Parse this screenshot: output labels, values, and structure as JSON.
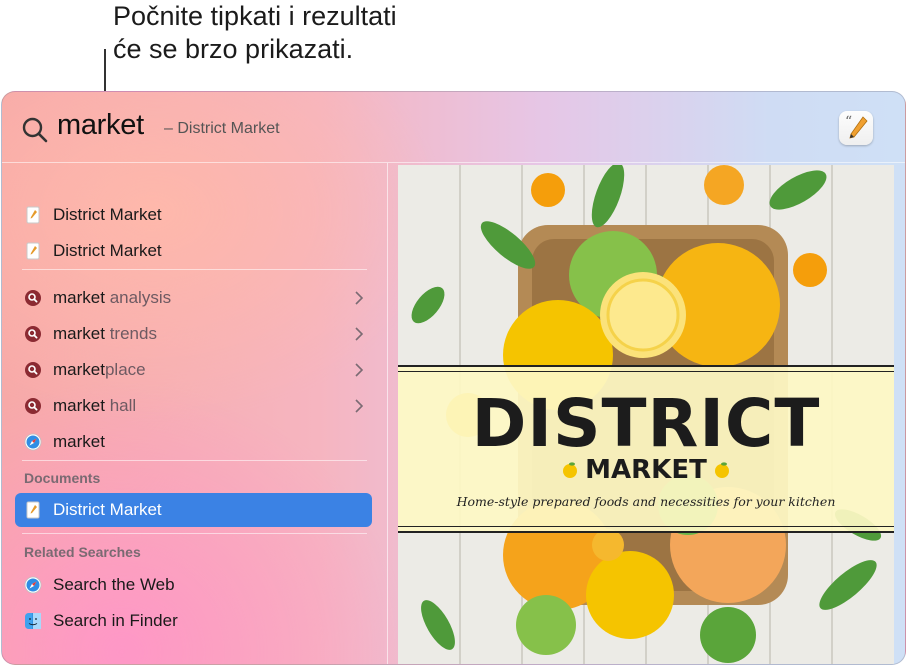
{
  "callout": {
    "line1": "Počnite tipkati i rezultati",
    "line2": "će se brzo prikazati."
  },
  "search": {
    "query": "market",
    "suggestion": "– District Market",
    "search_icon": "magnifier-icon",
    "action_icon": "pages-document-icon"
  },
  "results": {
    "top_hits": [
      {
        "label": "District Market",
        "icon": "pages-document-icon"
      },
      {
        "label": "District Market",
        "icon": "pages-document-icon"
      }
    ],
    "suggestions": [
      {
        "typed": "market",
        "rest": " analysis",
        "icon": "search-suggestion-icon"
      },
      {
        "typed": "market",
        "rest": " trends",
        "icon": "search-suggestion-icon"
      },
      {
        "typed": "market",
        "rest": "place",
        "icon": "search-suggestion-icon"
      },
      {
        "typed": "market",
        "rest": " hall",
        "icon": "search-suggestion-icon"
      },
      {
        "typed": "market",
        "rest": "",
        "icon": "safari-icon"
      }
    ],
    "documents_title": "Documents",
    "documents": [
      {
        "label": "District Market",
        "icon": "pages-document-icon",
        "selected": true
      }
    ],
    "related_title": "Related Searches",
    "related": [
      {
        "label": "Search the Web",
        "icon": "safari-icon"
      },
      {
        "label": "Search in Finder",
        "icon": "finder-icon"
      }
    ]
  },
  "preview": {
    "title": "DISTRICT",
    "subtitle": "MARKET",
    "tagline": "Home-style prepared foods and necessities for your kitchen"
  },
  "colors": {
    "selection": "#3b82e4",
    "suggestion_icon": "#8b2a32",
    "lemon": "#f5c400",
    "orange": "#f59e0b",
    "lime": "#6db33f"
  }
}
